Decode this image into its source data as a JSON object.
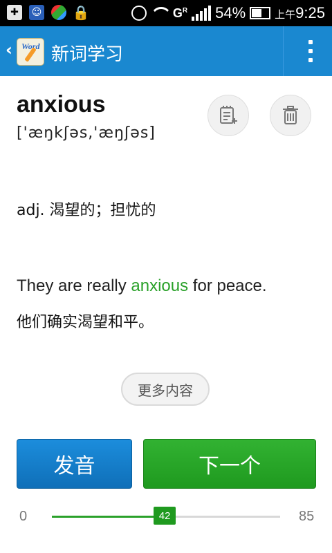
{
  "status_bar": {
    "battery": "54%",
    "time_prefix": "上午",
    "time": "9:25",
    "network": "G",
    "network_sup": "R"
  },
  "app_bar": {
    "title": "新词学习",
    "logo_text": "Word",
    "bg_color": "#1a88d0"
  },
  "word": {
    "headword": "anxious",
    "phonetic": "['æŋkʃəs,'æŋʃəs]",
    "definition": "adj. 渴望的；担忧的",
    "example": {
      "before": "They are really ",
      "highlight": "anxious",
      "after": " for peace."
    },
    "translation": "他们确实渴望和平。",
    "highlight_color": "#2aa12a"
  },
  "actions": {
    "more_label": "更多内容",
    "pronounce_label": "发音",
    "next_label": "下一个"
  },
  "progress": {
    "min": "0",
    "max": "85",
    "current": "42",
    "value": 42,
    "total": 85
  }
}
